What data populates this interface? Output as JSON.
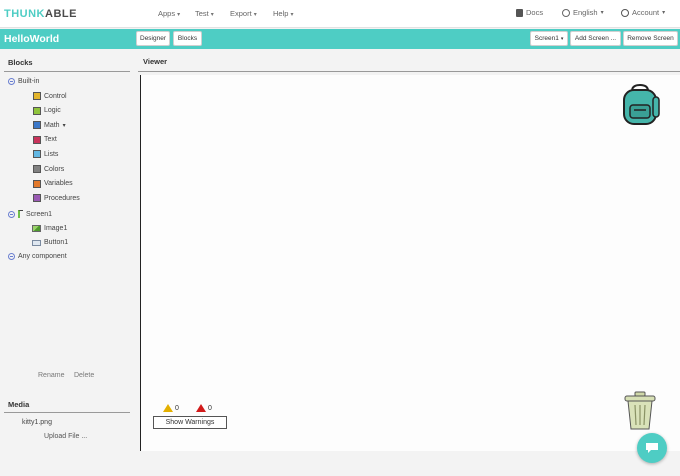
{
  "brand": {
    "part1": "THUNK",
    "part2": "ABLE",
    "accent": "#4ecdc4"
  },
  "nav": {
    "apps": "Apps",
    "test": "Test",
    "export": "Export",
    "help": "Help",
    "docs": "Docs",
    "language": "English",
    "account": "Account"
  },
  "appbar": {
    "project_name": "HelloWorld",
    "designer": "Designer",
    "blocks": "Blocks",
    "screen_select": "Screen1",
    "add_screen": "Add Screen ...",
    "remove_screen": "Remove Screen"
  },
  "blocks_panel": {
    "title": "Blocks",
    "builtin_label": "Built-in",
    "builtin_items": [
      {
        "label": "Control",
        "color": "#e3b52c"
      },
      {
        "label": "Logic",
        "color": "#8fc43c"
      },
      {
        "label": "Math",
        "color": "#3c78c8"
      },
      {
        "label": "Text",
        "color": "#c8325a"
      },
      {
        "label": "Lists",
        "color": "#62b7e3"
      },
      {
        "label": "Colors",
        "color": "#808080"
      },
      {
        "label": "Variables",
        "color": "#e37a2c"
      },
      {
        "label": "Procedures",
        "color": "#9a5ab4"
      }
    ],
    "screen_label": "Screen1",
    "components": [
      "Image1",
      "Button1"
    ],
    "any_component": "Any component",
    "rename": "Rename",
    "delete": "Delete"
  },
  "media_panel": {
    "title": "Media",
    "files": [
      "kitty1.png"
    ],
    "upload": "Upload File ..."
  },
  "viewer": {
    "title": "Viewer",
    "warnings_count": "0",
    "errors_count": "0",
    "show_warnings": "Show Warnings"
  }
}
